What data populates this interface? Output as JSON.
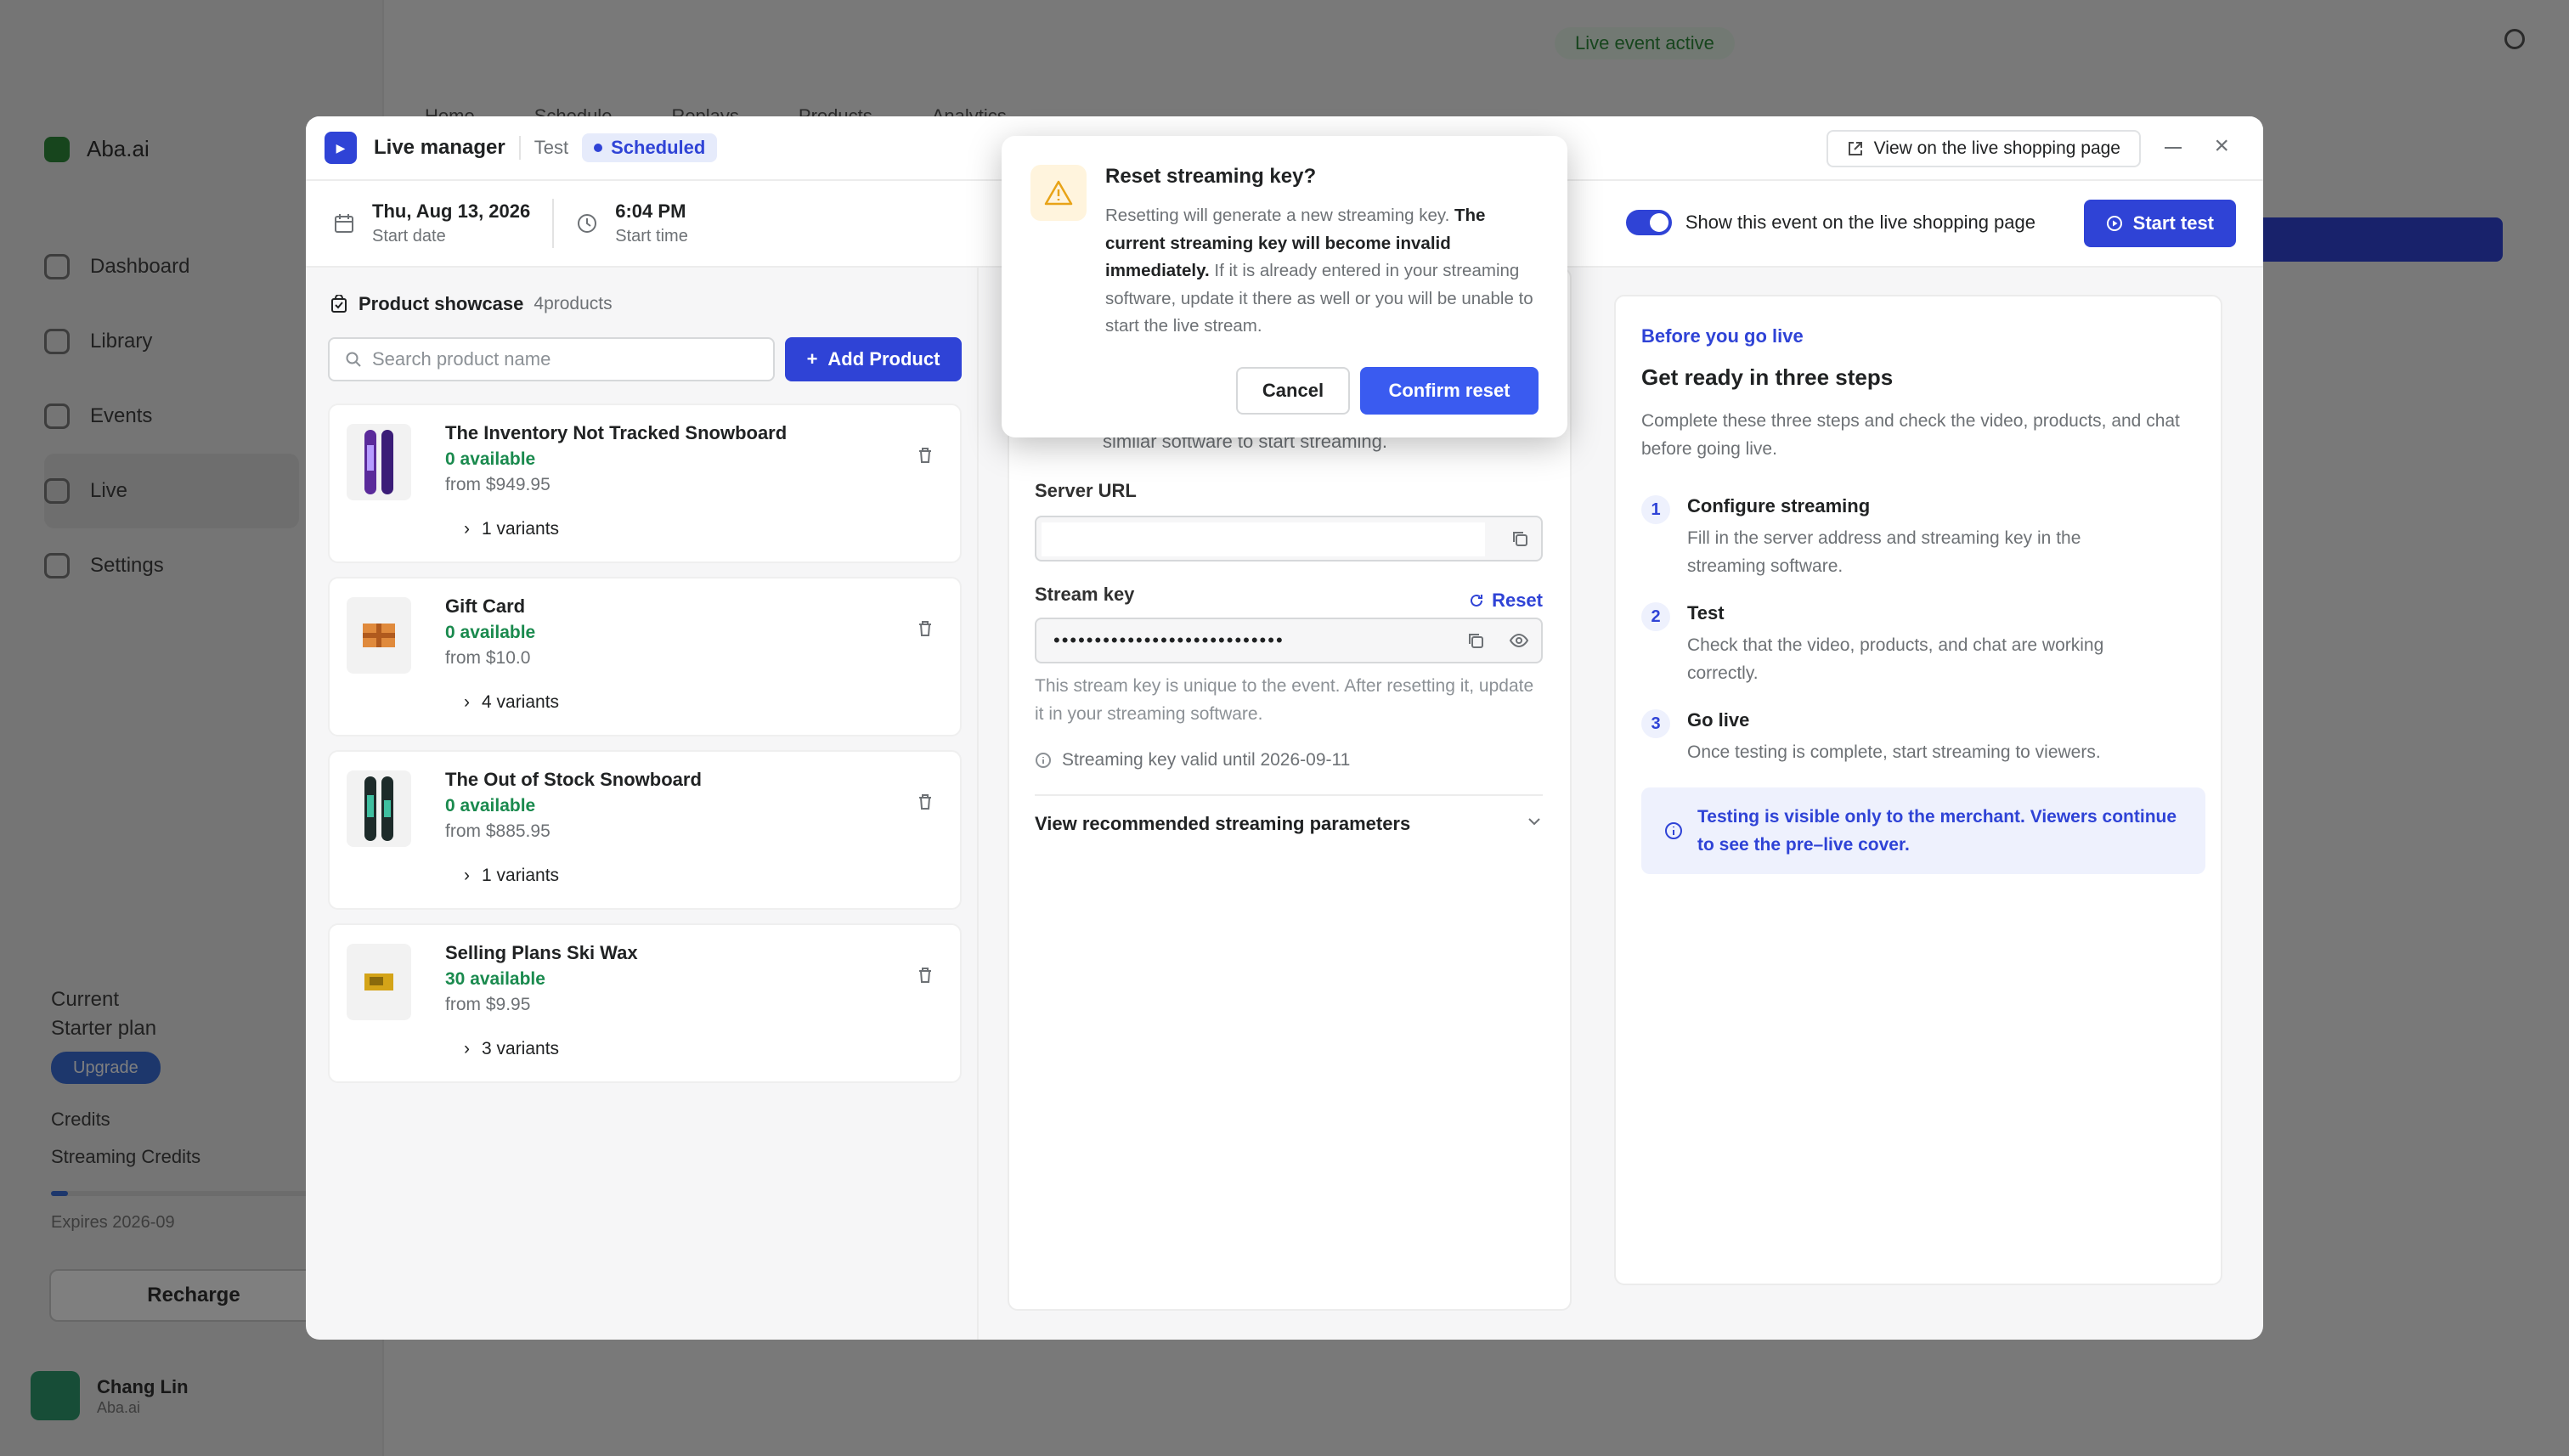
{
  "background": {
    "store_name": "Aba.ai",
    "status": "Live event active",
    "nav_items": [
      "Dashboard",
      "Library",
      "Events",
      "Live",
      "Settings"
    ],
    "top_tabs": [
      "Home",
      "Schedule",
      "Replays",
      "Products",
      "Analytics"
    ],
    "plan_label": "Current",
    "plan_name": "Starter plan",
    "plan_pill": "Upgrade",
    "credits_label": "Credits",
    "streaming_credits_label": "Streaming Credits",
    "expiry": "Expires 2026-09",
    "recharge": "Recharge",
    "user_name": "Chang Lin",
    "user_sub": "Aba.ai"
  },
  "modal": {
    "title": "Live manager",
    "test_label": "Test",
    "status_badge": "Scheduled",
    "view_button": "View on the live shopping page",
    "start_date_value": "Thu, Aug 13, 2026",
    "start_date_label": "Start date",
    "start_time_value": "6:04 PM",
    "start_time_label": "Start time",
    "show_event_label": "Show this event on the live shopping page",
    "start_test_button": "Start test"
  },
  "showcase": {
    "title": "Product showcase",
    "count": "4products",
    "search_placeholder": "Search product name",
    "add_button": "Add Product",
    "products": [
      {
        "name": "The Inventory Not Tracked Snowboard",
        "available": "0 available",
        "price": "from $949.95",
        "variants": "1 variants"
      },
      {
        "name": "Gift Card",
        "available": "0 available",
        "price": "from $10.0",
        "variants": "4 variants"
      },
      {
        "name": "The Out of Stock Snowboard",
        "available": "0 available",
        "price": "from $885.95",
        "variants": "1 variants"
      },
      {
        "name": "Selling Plans Ski Wax",
        "available": "30 available",
        "price": "from $9.95",
        "variants": "3 variants"
      }
    ]
  },
  "streaming": {
    "intro_tail": "similar software to start streaming.",
    "server_url_label": "Server URL",
    "server_url_value": "",
    "stream_key_label": "Stream key",
    "reset_link": "Reset",
    "stream_key_masked": "••••••••••••••••••••••••••••",
    "help": "This stream key is unique to the event. After resetting it, update it in your streaming software.",
    "valid_until": "Streaming key valid until 2026-09-11",
    "params_label": "View recommended streaming parameters"
  },
  "guide": {
    "eyebrow": "Before you go live",
    "title": "Get ready in three steps",
    "desc": "Complete these three steps and check the video, products, and chat before going live.",
    "steps": [
      {
        "num": "1",
        "title": "Configure streaming",
        "desc": "Fill in the server address and streaming key in the streaming software."
      },
      {
        "num": "2",
        "title": "Test",
        "desc": "Check that the video, products, and chat are working correctly."
      },
      {
        "num": "3",
        "title": "Go live",
        "desc": "Once testing is complete, start streaming to viewers."
      }
    ],
    "note": "Testing is visible only to the merchant. Viewers continue to see the pre–live cover."
  },
  "dialog": {
    "title": "Reset streaming key?",
    "body_1": "Resetting will generate a new streaming key.",
    "body_bold": "The current streaming key will become invalid immediately.",
    "body_2": "If it is already entered in your streaming software, update it there as well or you will be unable to start the live stream.",
    "cancel": "Cancel",
    "confirm": "Confirm reset"
  },
  "colors": {
    "accent": "#2f43d6",
    "confirm": "#3a5bf0",
    "available": "#1a8a4e",
    "warning": "#e8a317"
  }
}
